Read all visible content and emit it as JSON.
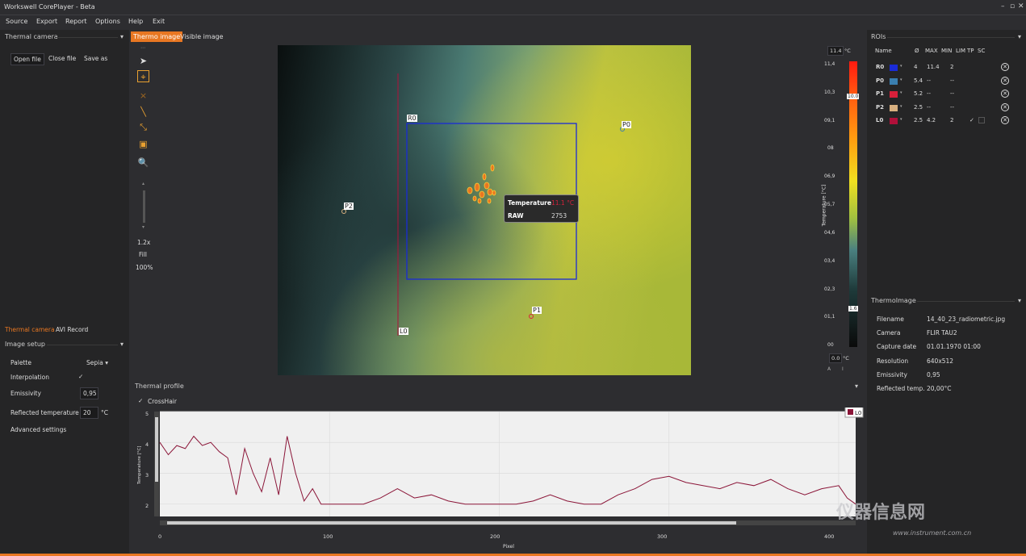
{
  "window": {
    "title": "Workswell CorePlayer - Beta"
  },
  "menu": [
    "Source",
    "Export",
    "Report",
    "Options",
    "Help",
    "Exit"
  ],
  "left": {
    "header": "Thermal camera",
    "open_file": "Open file",
    "close_file": "Close file",
    "save_as": "Save as",
    "tab_thermal": "Thermal camera",
    "tab_avi": "AVI Record",
    "image_setup": "Image setup",
    "palette_label": "Palette",
    "palette_value": "Sepia",
    "interpolation_label": "Interpolation",
    "interpolation_check": "✓",
    "emissivity_label": "Emissivity",
    "emissivity_value": "0,95",
    "reflected_label": "Reflected temperature",
    "reflected_value": "20",
    "reflected_unit": "°C",
    "advanced": "Advanced settings"
  },
  "view": {
    "tab_thermo": "Thermo image",
    "tab_visible": "Visible image",
    "zoom": "1.2x",
    "fill": "Fill",
    "percent": "100%"
  },
  "image": {
    "markers": {
      "R0": "R0",
      "P0": "P0",
      "P1": "P1",
      "P2": "P2",
      "L0": "L0"
    },
    "tooltip": {
      "temp_label": "Temperature",
      "temp_value": "11.1 °C",
      "raw_label": "RAW",
      "raw_value": "2753"
    }
  },
  "scale": {
    "max": "11.4",
    "min": "0.0",
    "unit": "°C",
    "axis_label": "Temperature [°C]",
    "ticks": [
      "11,4",
      "10,3",
      "09,1",
      "08",
      "06,9",
      "05,7",
      "04,6",
      "03,4",
      "02,3",
      "01,1",
      "00"
    ],
    "hi_marker": "10.0",
    "lo_marker": "1.6",
    "mode_a": "A",
    "mode_i": "I"
  },
  "profile": {
    "title": "Thermal profile",
    "crosshair": "CrossHair",
    "legend": "L0",
    "ylabel": "Temperature [°C]",
    "xlabel": "Pixel",
    "yticks": [
      "5",
      "4",
      "3",
      "2"
    ],
    "xticks": [
      "0",
      "100",
      "200",
      "300",
      "400"
    ]
  },
  "chart_data": {
    "type": "line",
    "xlabel": "Pixel",
    "ylabel": "Temperature [°C]",
    "xlim": [
      0,
      410
    ],
    "ylim": [
      1.6,
      5
    ],
    "series": [
      {
        "name": "L0",
        "x": [
          0,
          5,
          10,
          15,
          20,
          25,
          30,
          35,
          40,
          45,
          50,
          55,
          60,
          65,
          70,
          75,
          80,
          85,
          90,
          95,
          100,
          110,
          120,
          130,
          140,
          150,
          160,
          170,
          180,
          190,
          200,
          210,
          220,
          230,
          240,
          250,
          260,
          270,
          280,
          290,
          300,
          310,
          320,
          330,
          340,
          350,
          360,
          370,
          380,
          390,
          400,
          405,
          410
        ],
        "y": [
          4.0,
          3.6,
          3.9,
          3.8,
          4.2,
          3.9,
          4.0,
          3.7,
          3.5,
          2.3,
          3.8,
          3.0,
          2.4,
          3.5,
          2.3,
          4.2,
          3.0,
          2.1,
          2.5,
          2.0,
          2.0,
          2.0,
          2.0,
          2.2,
          2.5,
          2.2,
          2.3,
          2.1,
          2.0,
          2.0,
          2.0,
          2.0,
          2.1,
          2.3,
          2.1,
          2.0,
          2.0,
          2.3,
          2.5,
          2.8,
          2.9,
          2.7,
          2.6,
          2.5,
          2.7,
          2.6,
          2.8,
          2.5,
          2.3,
          2.5,
          2.6,
          2.2,
          2.0
        ]
      }
    ],
    "color": "#8b1538"
  },
  "rois": {
    "header": "ROIs",
    "columns": [
      "Name",
      "Ø",
      "MAX",
      "MIN",
      "LIM",
      "TP",
      "SC"
    ],
    "rows": [
      {
        "name": "R0",
        "color": "#1a2bd6",
        "avg": "4",
        "max": "11.4",
        "min": "2",
        "lim": "",
        "tp": "",
        "sc": ""
      },
      {
        "name": "P0",
        "color": "#3a7fb0",
        "avg": "5.4",
        "max": "--",
        "min": "--",
        "lim": "",
        "tp": "",
        "sc": ""
      },
      {
        "name": "P1",
        "color": "#d8203a",
        "avg": "5.2",
        "max": "--",
        "min": "--",
        "lim": "",
        "tp": "",
        "sc": ""
      },
      {
        "name": "P2",
        "color": "#d8b080",
        "avg": "2.5",
        "max": "--",
        "min": "--",
        "lim": "",
        "tp": "",
        "sc": ""
      },
      {
        "name": "L0",
        "color": "#b0103a",
        "avg": "2.5",
        "max": "4.2",
        "min": "2",
        "lim": "",
        "tp": "✓",
        "sc": ""
      }
    ]
  },
  "thermoimage": {
    "header": "ThermoImage",
    "rows": [
      {
        "k": "Filename",
        "v": "14_40_23_radiometric.jpg"
      },
      {
        "k": "Camera",
        "v": "FLIR TAU2"
      },
      {
        "k": "Capture date",
        "v": "01.01.1970 01:00"
      },
      {
        "k": "Resolution",
        "v": "640x512"
      },
      {
        "k": "Emissivity",
        "v": "0,95"
      },
      {
        "k": "Reflected temp.",
        "v": "20,00°C"
      }
    ]
  },
  "watermark": {
    "cn": "仪器信息网",
    "url": "www.instrument.com.cn"
  }
}
